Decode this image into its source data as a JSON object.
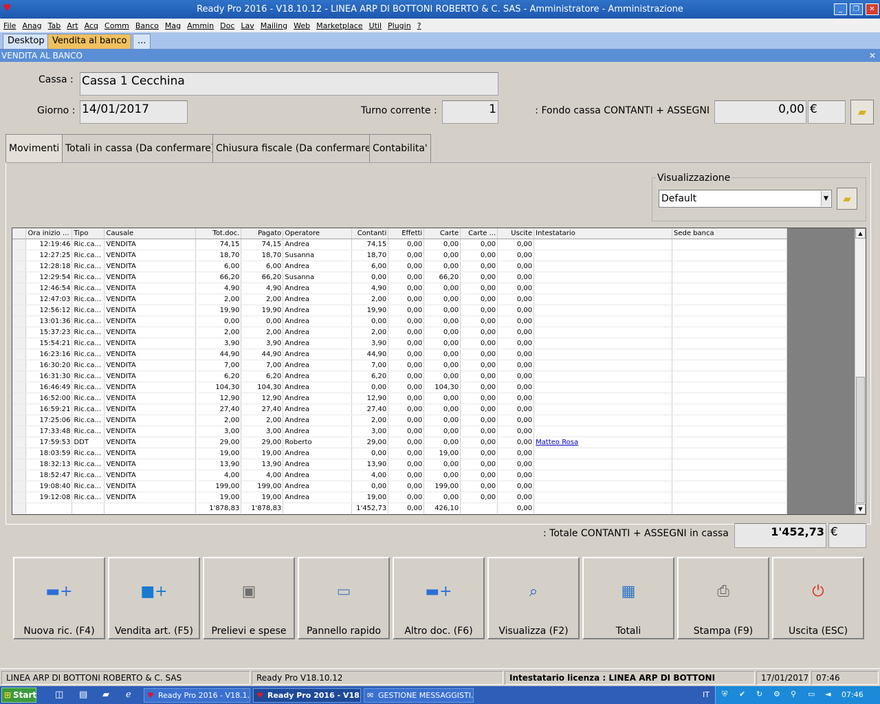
{
  "window": {
    "title": "Ready Pro 2016 - V18.10.12 - LINEA ARP DI BOTTONI ROBERTO & C. SAS - Amministratore - Amministrazione"
  },
  "menu": [
    "File",
    "Anag",
    "Tab",
    "Art",
    "Acq",
    "Comm",
    "Banco",
    "Mag",
    "Ammin",
    "Doc",
    "Lav",
    "Mailing",
    "Web",
    "Marketplace",
    "Util",
    "Plugin",
    "?"
  ],
  "doc_tabs": [
    "Desktop",
    "Vendita al banco",
    "..."
  ],
  "panel": {
    "title": "VENDITA AL BANCO"
  },
  "header": {
    "cassa_label": "Cassa :",
    "cassa_value": "Cassa 1 Cecchina",
    "giorno_label": "Giorno :",
    "giorno_value": "14/01/2017",
    "turno_label": "Turno corrente :",
    "turno_value": "1",
    "fondo_label": "Fondo cassa CONTANTI + ASSEGNI :",
    "fondo_value": "0,00",
    "currency": "€"
  },
  "tabs": [
    "Movimenti",
    "Totali in cassa (Da confermare)",
    "Chiusura fiscale (Da confermare)",
    "Contabilita'"
  ],
  "view": {
    "group_label": "Visualizzazione",
    "selected": "Default"
  },
  "columns": [
    "Ora inizio ...",
    "Tipo",
    "Causale",
    "Tot.doc.",
    "Pagato",
    "Operatore",
    "Contanti",
    "Effetti",
    "Carte",
    "Carte ...",
    "Uscite",
    "Intestatario",
    "Sede banca"
  ],
  "rows": [
    [
      "12:19:46",
      "Ric.ca...",
      "VENDITA",
      "74,15",
      "74,15",
      "Andrea",
      "74,15",
      "0,00",
      "0,00",
      "0,00",
      "0,00",
      "",
      ""
    ],
    [
      "12:27:25",
      "Ric.ca...",
      "VENDITA",
      "18,70",
      "18,70",
      "Susanna",
      "18,70",
      "0,00",
      "0,00",
      "0,00",
      "0,00",
      "",
      ""
    ],
    [
      "12:28:18",
      "Ric.ca...",
      "VENDITA",
      "6,00",
      "6,00",
      "Andrea",
      "6,00",
      "0,00",
      "0,00",
      "0,00",
      "0,00",
      "",
      ""
    ],
    [
      "12:29:54",
      "Ric.ca...",
      "VENDITA",
      "66,20",
      "66,20",
      "Susanna",
      "0,00",
      "0,00",
      "66,20",
      "0,00",
      "0,00",
      "",
      ""
    ],
    [
      "12:46:54",
      "Ric.ca...",
      "VENDITA",
      "4,90",
      "4,90",
      "Andrea",
      "4,90",
      "0,00",
      "0,00",
      "0,00",
      "0,00",
      "",
      ""
    ],
    [
      "12:47:03",
      "Ric.ca...",
      "VENDITA",
      "2,00",
      "2,00",
      "Andrea",
      "2,00",
      "0,00",
      "0,00",
      "0,00",
      "0,00",
      "",
      ""
    ],
    [
      "12:56:12",
      "Ric.ca...",
      "VENDITA",
      "19,90",
      "19,90",
      "Andrea",
      "19,90",
      "0,00",
      "0,00",
      "0,00",
      "0,00",
      "",
      ""
    ],
    [
      "13:01:36",
      "Ric.ca...",
      "VENDITA",
      "0,00",
      "0,00",
      "Andrea",
      "0,00",
      "0,00",
      "0,00",
      "0,00",
      "0,00",
      "",
      ""
    ],
    [
      "15:37:23",
      "Ric.ca...",
      "VENDITA",
      "2,00",
      "2,00",
      "Andrea",
      "2,00",
      "0,00",
      "0,00",
      "0,00",
      "0,00",
      "",
      ""
    ],
    [
      "15:54:21",
      "Ric.ca...",
      "VENDITA",
      "3,90",
      "3,90",
      "Andrea",
      "3,90",
      "0,00",
      "0,00",
      "0,00",
      "0,00",
      "",
      ""
    ],
    [
      "16:23:16",
      "Ric.ca...",
      "VENDITA",
      "44,90",
      "44,90",
      "Andrea",
      "44,90",
      "0,00",
      "0,00",
      "0,00",
      "0,00",
      "",
      ""
    ],
    [
      "16:30:20",
      "Ric.ca...",
      "VENDITA",
      "7,00",
      "7,00",
      "Andrea",
      "7,00",
      "0,00",
      "0,00",
      "0,00",
      "0,00",
      "",
      ""
    ],
    [
      "16:31:30",
      "Ric.ca...",
      "VENDITA",
      "6,20",
      "6,20",
      "Andrea",
      "6,20",
      "0,00",
      "0,00",
      "0,00",
      "0,00",
      "",
      ""
    ],
    [
      "16:46:49",
      "Ric.ca...",
      "VENDITA",
      "104,30",
      "104,30",
      "Andrea",
      "0,00",
      "0,00",
      "104,30",
      "0,00",
      "0,00",
      "",
      ""
    ],
    [
      "16:52:00",
      "Ric.ca...",
      "VENDITA",
      "12,90",
      "12,90",
      "Andrea",
      "12,90",
      "0,00",
      "0,00",
      "0,00",
      "0,00",
      "",
      ""
    ],
    [
      "16:59:21",
      "Ric.ca...",
      "VENDITA",
      "27,40",
      "27,40",
      "Andrea",
      "27,40",
      "0,00",
      "0,00",
      "0,00",
      "0,00",
      "",
      ""
    ],
    [
      "17:25:06",
      "Ric.ca...",
      "VENDITA",
      "2,00",
      "2,00",
      "Andrea",
      "2,00",
      "0,00",
      "0,00",
      "0,00",
      "0,00",
      "",
      ""
    ],
    [
      "17:33:48",
      "Ric.ca...",
      "VENDITA",
      "3,00",
      "3,00",
      "Andrea",
      "3,00",
      "0,00",
      "0,00",
      "0,00",
      "0,00",
      "",
      ""
    ],
    [
      "17:59:53",
      "DDT",
      "VENDITA",
      "29,00",
      "29,00",
      "Roberto",
      "29,00",
      "0,00",
      "0,00",
      "0,00",
      "0,00",
      "Matteo Rosa",
      ""
    ],
    [
      "18:03:59",
      "Ric.ca...",
      "VENDITA",
      "19,00",
      "19,00",
      "Andrea",
      "0,00",
      "0,00",
      "19,00",
      "0,00",
      "0,00",
      "",
      ""
    ],
    [
      "18:32:13",
      "Ric.ca...",
      "VENDITA",
      "13,90",
      "13,90",
      "Andrea",
      "13,90",
      "0,00",
      "0,00",
      "0,00",
      "0,00",
      "",
      ""
    ],
    [
      "18:52:47",
      "Ric.ca...",
      "VENDITA",
      "4,00",
      "4,00",
      "Andrea",
      "4,00",
      "0,00",
      "0,00",
      "0,00",
      "0,00",
      "",
      ""
    ],
    [
      "19:08:40",
      "Ric.ca...",
      "VENDITA",
      "199,00",
      "199,00",
      "Andrea",
      "0,00",
      "0,00",
      "199,00",
      "0,00",
      "0,00",
      "",
      ""
    ],
    [
      "19:12:08",
      "Ric.ca...",
      "VENDITA",
      "19,00",
      "19,00",
      "Andrea",
      "19,00",
      "0,00",
      "0,00",
      "0,00",
      "0,00",
      "",
      ""
    ]
  ],
  "totals_row": [
    "",
    "",
    "",
    "1'878,83",
    "1'878,83",
    "",
    "1'452,73",
    "0,00",
    "426,10",
    "",
    "0,00",
    "",
    ""
  ],
  "totale_cassa": {
    "label": "Totale CONTANTI + ASSEGNI in cassa :",
    "value": "1'452,73",
    "currency": "€"
  },
  "buttons": [
    {
      "label": "Nuova ric. (F4)",
      "icon": "new-receipt-icon",
      "glyph": "▬+",
      "color": "#2a6fd8"
    },
    {
      "label": "Vendita art. (F5)",
      "icon": "cube-add-icon",
      "glyph": "■+",
      "color": "#1a7ad0"
    },
    {
      "label": "Prelievi e spese",
      "icon": "safe-icon",
      "glyph": "▣",
      "color": "#707070"
    },
    {
      "label": "Pannello rapido",
      "icon": "monitor-icon",
      "glyph": "▭",
      "color": "#5080c0"
    },
    {
      "label": "Altro doc. (F6)",
      "icon": "other-doc-icon",
      "glyph": "▬+",
      "color": "#2a6fd8"
    },
    {
      "label": "Visualizza (F2)",
      "icon": "preview-icon",
      "glyph": "⌕",
      "color": "#2060c0"
    },
    {
      "label": "Totali",
      "icon": "calculator-icon",
      "glyph": "▦",
      "color": "#2a70c8"
    },
    {
      "label": "Stampa (F9)",
      "icon": "printer-icon",
      "glyph": "⎙",
      "color": "#606060"
    },
    {
      "label": "Uscita (ESC)",
      "icon": "power-icon",
      "glyph": "⏻",
      "color": "#e03020"
    }
  ],
  "status": {
    "company": "LINEA ARP DI BOTTONI ROBERTO & C. SAS",
    "version": "Ready Pro V18.10.12",
    "license": "Intestatario licenza : LINEA ARP DI BOTTONI ROBERTO SAS",
    "date": "17/01/2017",
    "time": "07:46"
  },
  "taskbar": {
    "start": "Start",
    "items": [
      "Ready Pro 2016 - V18.1...",
      "Ready Pro 2016 - V18...",
      "GESTIONE MESSAGGISTI..."
    ],
    "lang": "IT",
    "clock": "07:46"
  }
}
